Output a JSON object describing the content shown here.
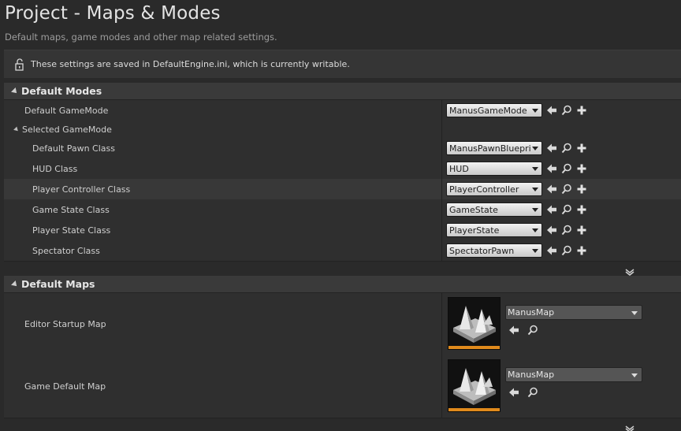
{
  "header": {
    "title": "Project - Maps & Modes",
    "subtitle": "Default maps, game modes and other map related settings."
  },
  "notice": {
    "text": "These settings are saved in DefaultEngine.ini, which is currently writable.",
    "icon": "unlocked-icon"
  },
  "default_modes": {
    "title": "Default Modes",
    "default_gamemode": {
      "label": "Default GameMode",
      "value": "ManusGameMode"
    },
    "selected_gamemode": {
      "label": "Selected GameMode",
      "rows": [
        {
          "label": "Default Pawn Class",
          "value": "ManusPawnBlueprint"
        },
        {
          "label": "HUD Class",
          "value": "HUD"
        },
        {
          "label": "Player Controller Class",
          "value": "PlayerController"
        },
        {
          "label": "Game State Class",
          "value": "GameState"
        },
        {
          "label": "Player State Class",
          "value": "PlayerState"
        },
        {
          "label": "Spectator Class",
          "value": "SpectatorPawn"
        }
      ]
    }
  },
  "default_maps": {
    "title": "Default Maps",
    "rows": [
      {
        "label": "Editor Startup Map",
        "value": "ManusMap"
      },
      {
        "label": "Game Default Map",
        "value": "ManusMap"
      }
    ]
  },
  "colors": {
    "background": "#2a2a2a",
    "accent": "#e08a1c"
  }
}
